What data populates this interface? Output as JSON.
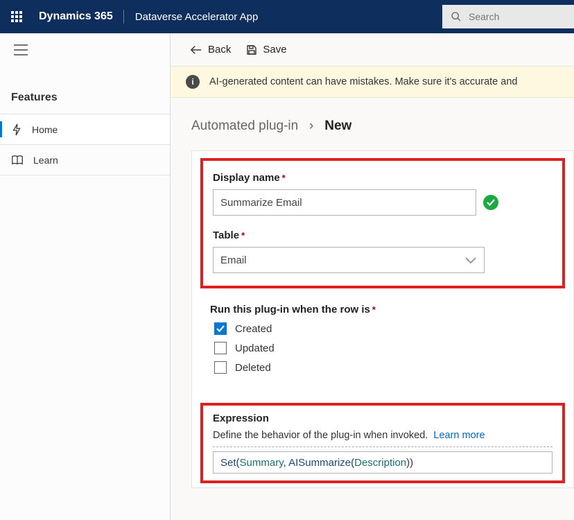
{
  "topbar": {
    "brand": "Dynamics 365",
    "app_name": "Dataverse Accelerator App",
    "search_placeholder": "Search"
  },
  "sidebar": {
    "section_label": "Features",
    "items": [
      {
        "label": "Home"
      },
      {
        "label": "Learn"
      }
    ]
  },
  "commandbar": {
    "back": "Back",
    "save": "Save"
  },
  "alert": {
    "text": "AI-generated content can have mistakes. Make sure it's accurate and"
  },
  "breadcrumb": {
    "root": "Automated plug-in",
    "current": "New"
  },
  "form": {
    "display_name_label": "Display name",
    "display_name_value": "Summarize Email",
    "table_label": "Table",
    "table_value": "Email",
    "trigger_label": "Run this plug-in when the row is",
    "triggers": {
      "created": "Created",
      "updated": "Updated",
      "deleted": "Deleted"
    },
    "expression_label": "Expression",
    "expression_desc": "Define the behavior of the plug-in when invoked.",
    "learn_more": "Learn more",
    "expr": {
      "fn_set": "Set",
      "arg1": "Summary",
      "fn_ai": "AISummarize",
      "arg2": "Description"
    }
  }
}
